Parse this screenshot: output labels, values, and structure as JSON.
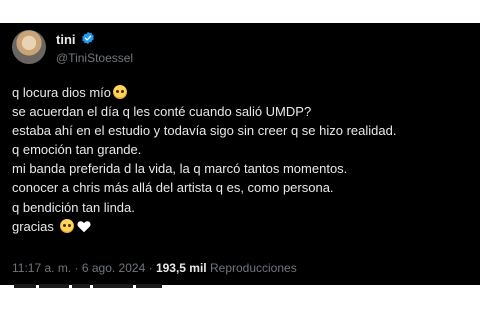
{
  "author": {
    "name": "tini",
    "handle": "@TiniStoessel",
    "verified_color": "#1d9bf0"
  },
  "tweet": {
    "lines": [
      "q locura dios mío",
      "se acuerdan el día q les conté cuando salió UMDP?",
      "estaba ahí en el estudio y todavía sigo sin creer q se hizo realidad.",
      "q emoción tan grande.",
      "mi banda preferida d la vida, la q marcó tantos momentos.",
      "conocer a chris más allá del artista q es, como persona.",
      "q bendición tan linda.",
      "gracias"
    ],
    "emojis": [
      "pleading-face",
      "pleading-face",
      "white-heart"
    ]
  },
  "meta": {
    "time": "11:17 a. m.",
    "separator": "·",
    "date": "6 ago. 2024",
    "views_count": "193,5 mil",
    "views_label": "Reproducciones"
  },
  "colors": {
    "background": "#000000",
    "text": "#e7e9ea",
    "secondary_text": "#71767b"
  }
}
